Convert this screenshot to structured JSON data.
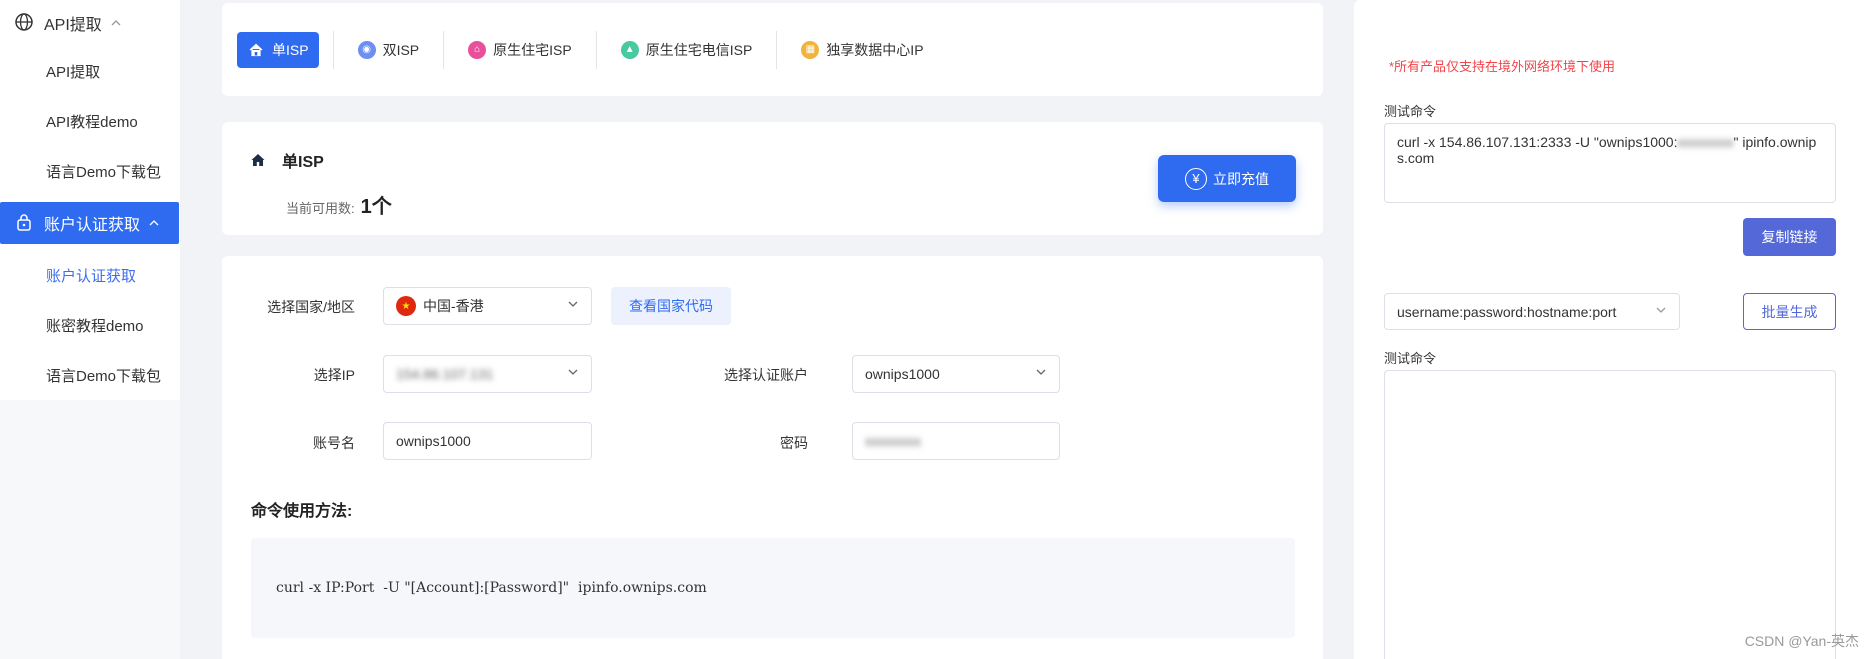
{
  "sidebar": {
    "groups": [
      {
        "label": "API提取",
        "icon": "globe-icon",
        "items": [
          "API提取",
          "API教程demo",
          "语言Demo下载包"
        ]
      },
      {
        "label": "账户认证获取",
        "icon": "lock-icon",
        "items": [
          "账户认证获取",
          "账密教程demo",
          "语言Demo下载包"
        ]
      }
    ]
  },
  "tabs": [
    {
      "label": "单ISP",
      "icon": "home-icon",
      "color": "#2f6bf1"
    },
    {
      "label": "双ISP",
      "icon": "dual-isp-icon",
      "color": "#6c8ef5"
    },
    {
      "label": "原生住宅ISP",
      "icon": "residential-icon",
      "color": "#e8509a"
    },
    {
      "label": "原生住宅电信ISP",
      "icon": "telecom-icon",
      "color": "#49c9a0"
    },
    {
      "label": "独享数据中心IP",
      "icon": "datacenter-icon",
      "color": "#f0b43c"
    }
  ],
  "info": {
    "title": "单ISP",
    "available_label": "当前可用数:",
    "available_value": "1个",
    "recharge_label": "立即充值"
  },
  "form": {
    "country_label": "选择国家/地区",
    "country_value": "中国-香港",
    "country_code_button": "查看国家代码",
    "ip_label": "选择IP",
    "ip_value": "154.86.107.131",
    "auth_account_label": "选择认证账户",
    "auth_account_value": "ownips1000",
    "account_name_label": "账号名",
    "account_name_value": "ownips1000",
    "password_label": "密码",
    "password_value": "xxxxxxxx",
    "usage_title": "命令使用方法:",
    "usage_code": "curl -x IP:Port  -U \"[Account]:[Password]\"  ipinfo.ownips.com"
  },
  "right": {
    "notice": "*所有产品仅支持在境外网络环境下使用",
    "test_cmd_label": "测试命令",
    "test_cmd_prefix": "curl -x 154.86.107.131:2333 -U \"ownips1000:",
    "test_cmd_secret": "xxxxxxxx",
    "test_cmd_suffix": "\" ipinfo.ownips.com",
    "copy_button": "复制链接",
    "format_value": "username:password:hostname:port",
    "batch_button": "批量生成",
    "test_cmd_label_2": "测试命令"
  },
  "watermark": "CSDN @Yan-英杰"
}
